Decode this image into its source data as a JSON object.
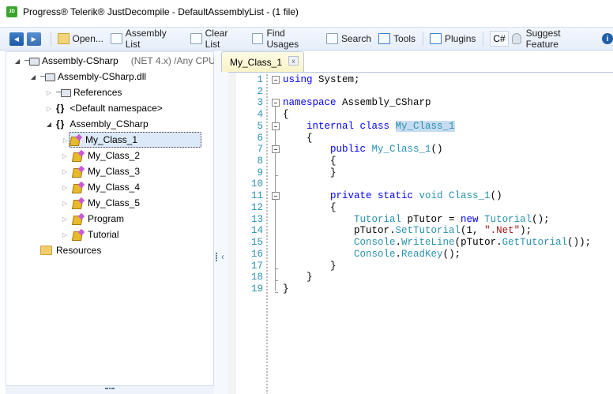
{
  "window": {
    "title": "Progress® Telerik® JustDecompile - DefaultAssemblyList - (1 file)",
    "logo": "JD"
  },
  "toolbar": {
    "items": [
      {
        "label": "Open...",
        "icon": "open-folder-icon"
      },
      {
        "label": "Assembly List",
        "icon": "assembly-list-icon"
      },
      {
        "label": "Clear List",
        "icon": "clear-list-icon"
      },
      {
        "label": "Find Usages",
        "icon": "find-usages-icon"
      },
      {
        "label": "Search",
        "icon": "search-icon"
      },
      {
        "label": "Tools",
        "icon": "tools-icon"
      },
      {
        "label": "Plugins",
        "icon": "plugins-icon"
      }
    ],
    "language": "C#",
    "suggest": "Suggest Feature"
  },
  "tree": {
    "root": "Assembly-CSharp",
    "root_meta": "(NET 4.x) /Any CPU",
    "dll": "Assembly-CSharp.dll",
    "references": "References",
    "default_ns": "<Default namespace>",
    "namespace": "Assembly_CSharp",
    "classes": [
      "My_Class_1",
      "My_Class_2",
      "My_Class_3",
      "My_Class_4",
      "My_Class_5",
      "Program",
      "Tutorial"
    ],
    "selected": "My_Class_1",
    "resources": "Resources"
  },
  "editor": {
    "tab": "My_Class_1",
    "tab_close": "x",
    "lines": [
      [
        [
          "using ",
          "kw"
        ],
        [
          "System;",
          "pl"
        ]
      ],
      [],
      [
        [
          "namespace ",
          "kw"
        ],
        [
          "Assembly_CSharp",
          "pl"
        ]
      ],
      [
        [
          "{",
          "pl"
        ]
      ],
      [
        [
          "    internal class ",
          "kw"
        ],
        [
          "My_Class_1",
          "ty hl"
        ]
      ],
      [
        [
          "    {",
          "pl"
        ]
      ],
      [
        [
          "        public ",
          "kw"
        ],
        [
          "My_Class_1",
          "ty"
        ],
        [
          "()",
          "pl"
        ]
      ],
      [
        [
          "        {",
          "pl"
        ]
      ],
      [
        [
          "        }",
          "pl"
        ]
      ],
      [],
      [
        [
          "        private static ",
          "kw"
        ],
        [
          "void ",
          "ty"
        ],
        [
          "Class_1",
          "ty"
        ],
        [
          "()",
          "pl"
        ]
      ],
      [
        [
          "        {",
          "pl"
        ]
      ],
      [
        [
          "            Tutorial",
          "ty"
        ],
        [
          " pTutor = ",
          "pl"
        ],
        [
          "new ",
          "kw"
        ],
        [
          "Tutorial",
          "ty"
        ],
        [
          "();",
          "pl"
        ]
      ],
      [
        [
          "            pTutor.",
          "pl"
        ],
        [
          "SetTutorial",
          "ty"
        ],
        [
          "(1, ",
          "pl"
        ],
        [
          "\".Net\"",
          "st"
        ],
        [
          ");",
          "pl"
        ]
      ],
      [
        [
          "            Console",
          "ty"
        ],
        [
          ".",
          "pl"
        ],
        [
          "WriteLine",
          "ty"
        ],
        [
          "(pTutor.",
          "pl"
        ],
        [
          "GetTutorial",
          "ty"
        ],
        [
          "());",
          "pl"
        ]
      ],
      [
        [
          "            Console",
          "ty"
        ],
        [
          ".",
          "pl"
        ],
        [
          "ReadKey",
          "ty"
        ],
        [
          "();",
          "pl"
        ]
      ],
      [
        [
          "        }",
          "pl"
        ]
      ],
      [
        [
          "    }",
          "pl"
        ]
      ],
      [
        [
          "}",
          "pl"
        ]
      ]
    ]
  }
}
